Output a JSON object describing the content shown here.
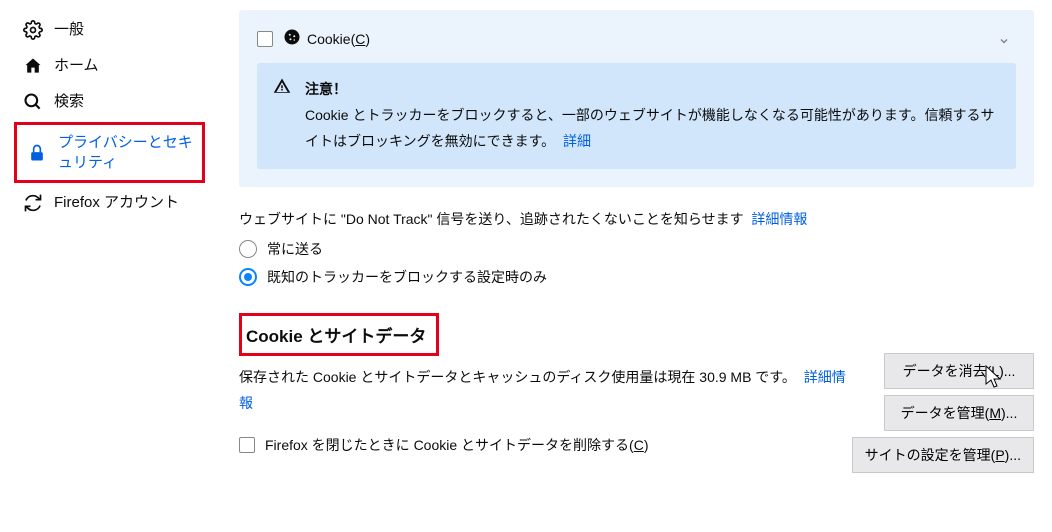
{
  "sidebar": {
    "items": [
      {
        "label": "一般",
        "icon": "gear"
      },
      {
        "label": "ホーム",
        "icon": "home"
      },
      {
        "label": "検索",
        "icon": "search"
      },
      {
        "label": "プライバシーとセキュリティ",
        "icon": "lock"
      },
      {
        "label": "Firefox アカウント",
        "icon": "sync"
      }
    ]
  },
  "cookie_panel": {
    "cookie_label_prefix": "Cookie(",
    "cookie_label_key": "C",
    "cookie_label_suffix": ")",
    "warning_title": "注意！",
    "warning_body": "Cookie とトラッカーをブロックすると、一部のウェブサイトが機能しなくなる可能性があります。信頼するサイトはブロッキングを無効にできます。",
    "warning_link": "詳細"
  },
  "dnt": {
    "intro": "ウェブサイトに \"Do Not Track\" 信号を送り、追跡されたくないことを知らせます",
    "more_link": "詳細情報",
    "opt_always": "常に送る",
    "opt_known": "既知のトラッカーをブロックする設定時のみ"
  },
  "cookie_data": {
    "heading": "Cookie とサイトデータ",
    "desc_prefix": "保存された Cookie とサイトデータとキャッシュのディスク使用量は現在 ",
    "desc_size": "30.9 MB",
    "desc_suffix": " です。",
    "more_link": "詳細情報",
    "delete_on_close_prefix": "Firefox を閉じたときに Cookie とサイトデータを削除する(",
    "delete_on_close_key": "C",
    "delete_on_close_suffix": ")",
    "btn_clear_prefix": "データを消去(",
    "btn_clear_key": "L",
    "btn_clear_suffix": ")...",
    "btn_manage_prefix": "データを管理(",
    "btn_manage_key": "M",
    "btn_manage_suffix": ")...",
    "btn_perms_prefix": "サイトの設定を管理(",
    "btn_perms_key": "P",
    "btn_perms_suffix": ")..."
  }
}
